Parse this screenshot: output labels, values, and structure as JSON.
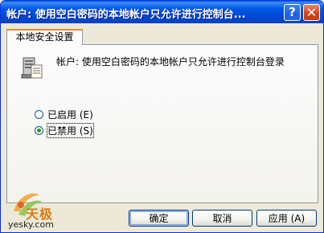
{
  "window": {
    "title": "帐户: 使用空白密码的本地帐户只允许进行控制台...",
    "help_button": "?",
    "close_button": "✕"
  },
  "tabs": [
    {
      "label": "本地安全设置"
    }
  ],
  "policy": {
    "icon": "policy-server-icon",
    "description": "帐户: 使用空白密码的本地帐户只允许进行控制台登录"
  },
  "options": [
    {
      "label": "已启用 (E)",
      "selected": false
    },
    {
      "label": "已禁用 (S)",
      "selected": true
    }
  ],
  "buttons": {
    "ok": "确定",
    "cancel": "取消",
    "apply": "应用 (A)"
  },
  "watermark": {
    "brand": "天极",
    "site": "yesky.com"
  },
  "colors": {
    "titlebar": "#0054e3",
    "dialog_bg": "#ece9d8",
    "tab_accent": "#e68b2c",
    "radio_dot": "#21a121"
  }
}
